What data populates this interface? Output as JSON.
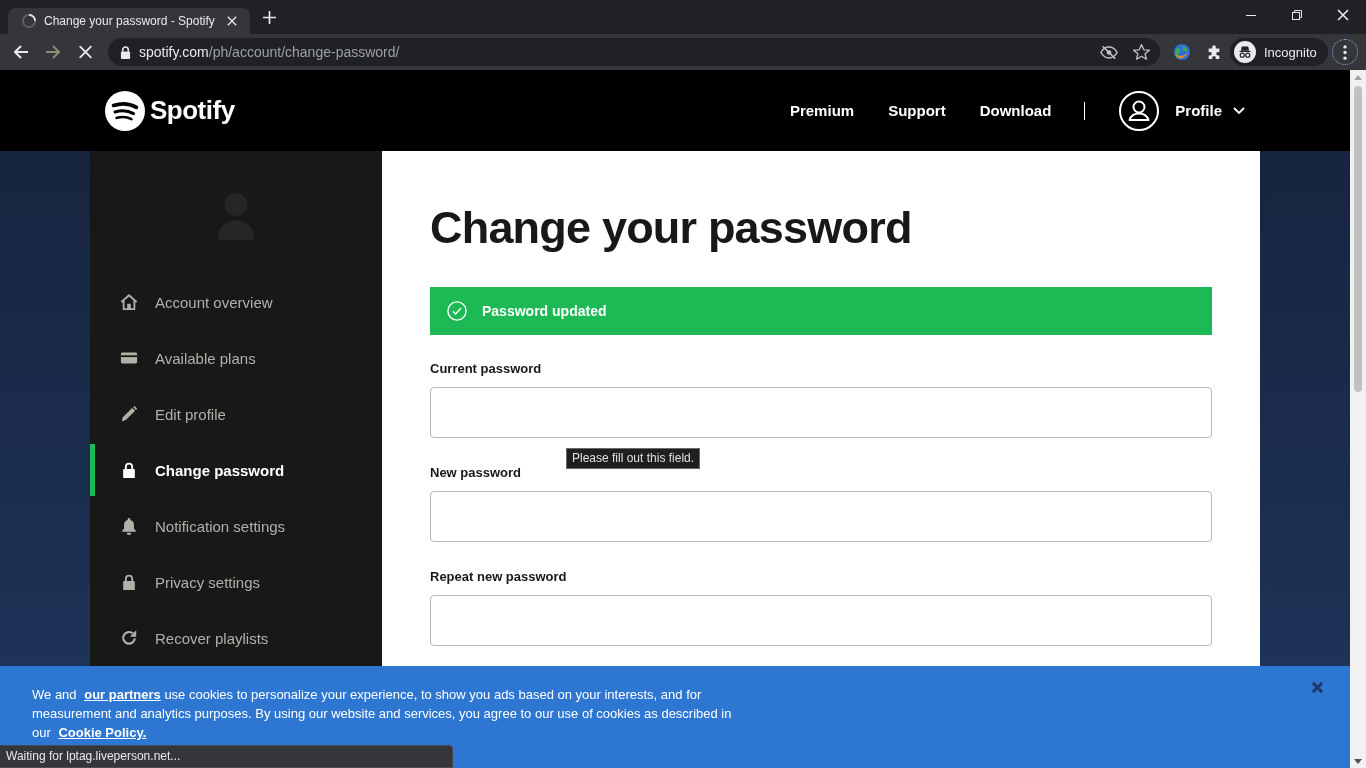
{
  "browser": {
    "tabs": [
      {
        "title": "Change your password - Spotify",
        "selected": true,
        "loading": true
      }
    ],
    "nav_buttons": [
      {
        "kind": "back",
        "disabled": false
      },
      {
        "kind": "forward",
        "disabled": true
      },
      {
        "kind": "stop",
        "disabled": false
      }
    ],
    "address": {
      "host": "spotify.com",
      "path": "/ph/account/change-password/"
    },
    "profile": {
      "label": "Incognito"
    },
    "status": "Waiting for lptag.liveperson.net..."
  },
  "header": {
    "logo": "Spotify",
    "nav": [
      "Premium",
      "Support",
      "Download"
    ],
    "profile": {
      "label": "Profile"
    }
  },
  "sidebar": {
    "items": [
      {
        "label": "Account overview",
        "selected": false
      },
      {
        "label": "Available plans",
        "selected": false
      },
      {
        "label": "Edit profile",
        "selected": false
      },
      {
        "label": "Change password",
        "selected": true
      },
      {
        "label": "Notification settings",
        "selected": false
      },
      {
        "label": "Privacy settings",
        "selected": false
      },
      {
        "label": "Recover playlists",
        "selected": false
      }
    ]
  },
  "main": {
    "title": "Change your password",
    "alert": {
      "text": "Password updated"
    },
    "fields": [
      {
        "label": "Current password",
        "validation_message": "Please fill out this field."
      },
      {
        "label": "New password"
      },
      {
        "label": "Repeat new password"
      }
    ]
  },
  "cookie_banner": {
    "segments": [
      {
        "kind": "text",
        "text": "We and "
      },
      {
        "kind": "link",
        "text": "our partners"
      },
      {
        "kind": "text",
        "text": " use cookies to personalize your experience, to show you ads based on your interests, and for measurement and analytics purposes. By using our website and services, you agree to our use of cookies as described in our "
      },
      {
        "kind": "link",
        "text": "Cookie Policy."
      }
    ]
  }
}
